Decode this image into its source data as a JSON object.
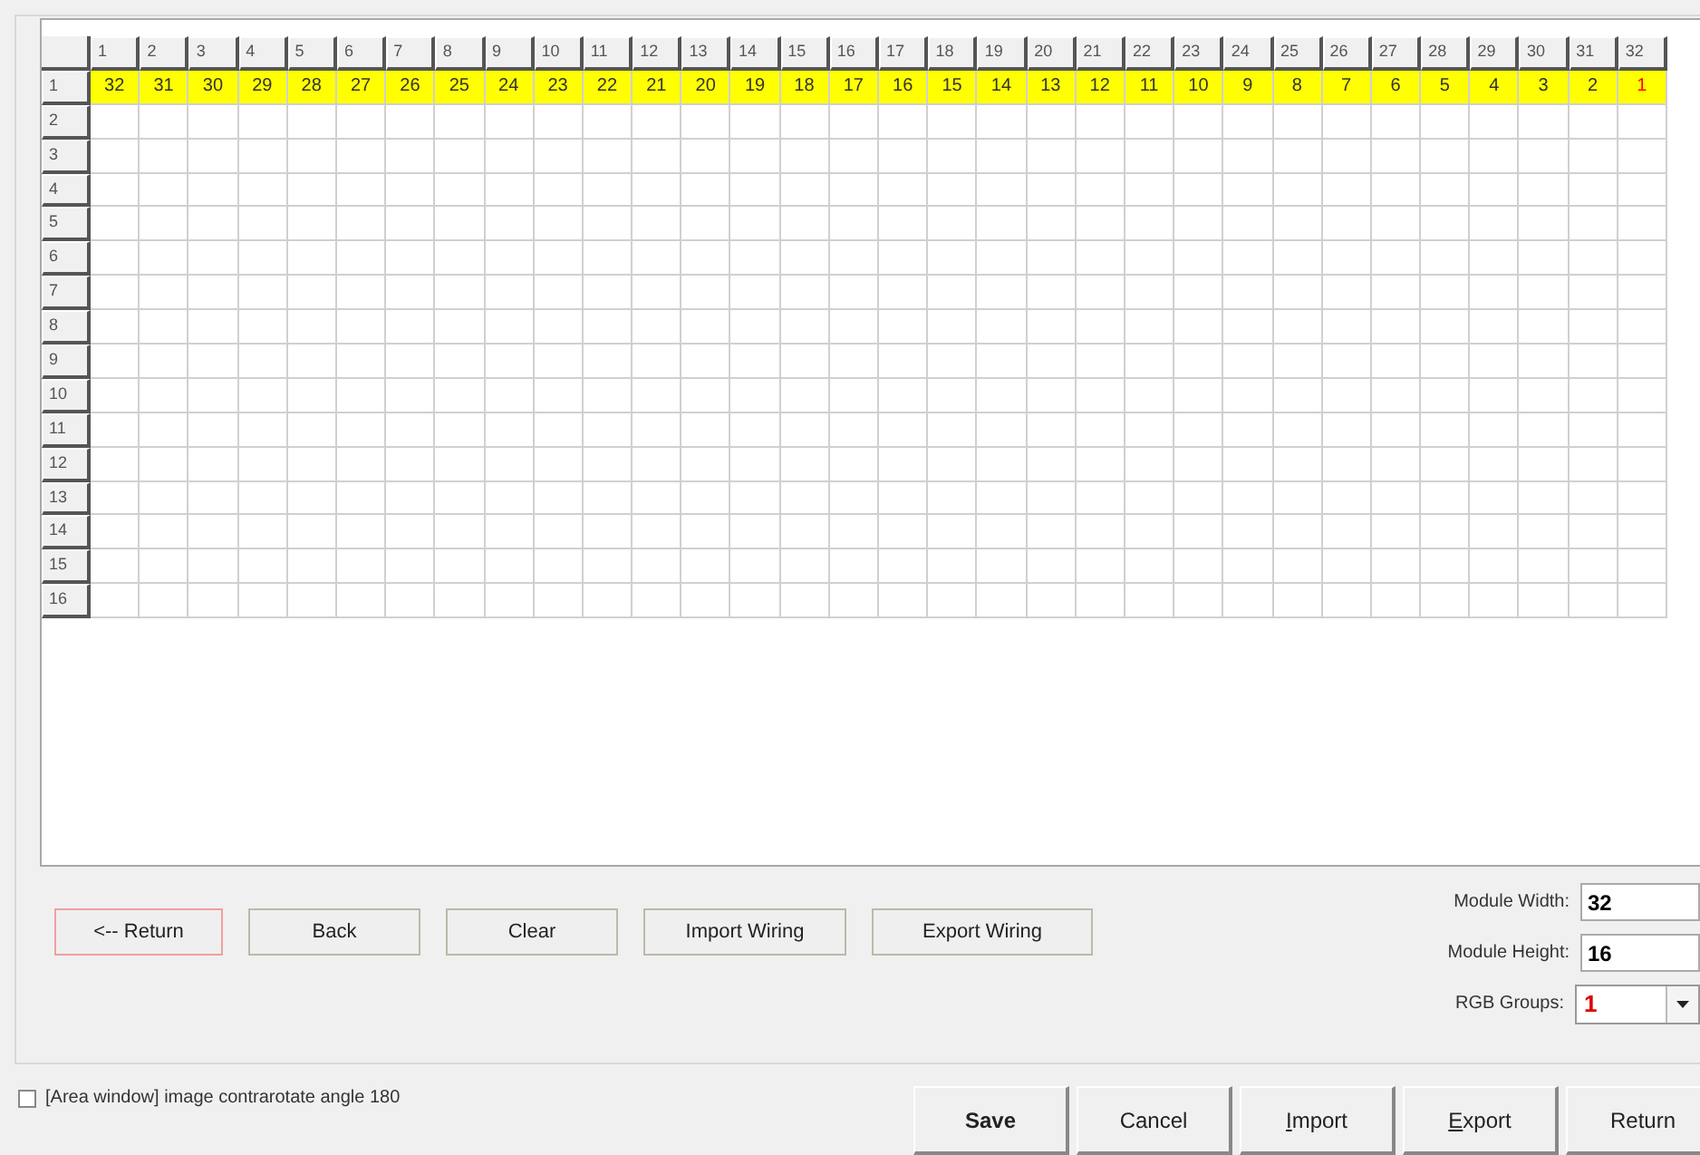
{
  "grid": {
    "column_headers": [
      "1",
      "2",
      "3",
      "4",
      "5",
      "6",
      "7",
      "8",
      "9",
      "10",
      "11",
      "12",
      "13",
      "14",
      "15",
      "16",
      "17",
      "18",
      "19",
      "20",
      "21",
      "22",
      "23",
      "24",
      "25",
      "26",
      "27",
      "28",
      "29",
      "30",
      "31",
      "32"
    ],
    "rows": [
      {
        "header": "1",
        "highlighted": true,
        "cells": [
          {
            "text": "32",
            "marked": false
          },
          {
            "text": "31",
            "marked": false
          },
          {
            "text": "30",
            "marked": false
          },
          {
            "text": "29",
            "marked": false
          },
          {
            "text": "28",
            "marked": false
          },
          {
            "text": "27",
            "marked": false
          },
          {
            "text": "26",
            "marked": false
          },
          {
            "text": "25",
            "marked": false
          },
          {
            "text": "24",
            "marked": false
          },
          {
            "text": "23",
            "marked": false
          },
          {
            "text": "22",
            "marked": false
          },
          {
            "text": "21",
            "marked": false
          },
          {
            "text": "20",
            "marked": false
          },
          {
            "text": "19",
            "marked": false
          },
          {
            "text": "18",
            "marked": false
          },
          {
            "text": "17",
            "marked": false
          },
          {
            "text": "16",
            "marked": false
          },
          {
            "text": "15",
            "marked": false
          },
          {
            "text": "14",
            "marked": false
          },
          {
            "text": "13",
            "marked": false
          },
          {
            "text": "12",
            "marked": false
          },
          {
            "text": "11",
            "marked": false
          },
          {
            "text": "10",
            "marked": false
          },
          {
            "text": "9",
            "marked": false
          },
          {
            "text": "8",
            "marked": false
          },
          {
            "text": "7",
            "marked": false
          },
          {
            "text": "6",
            "marked": false
          },
          {
            "text": "5",
            "marked": false
          },
          {
            "text": "4",
            "marked": false
          },
          {
            "text": "3",
            "marked": false
          },
          {
            "text": "2",
            "marked": false
          },
          {
            "text": "1",
            "marked": true
          }
        ]
      },
      {
        "header": "2",
        "highlighted": false
      },
      {
        "header": "3",
        "highlighted": false
      },
      {
        "header": "4",
        "highlighted": false
      },
      {
        "header": "5",
        "highlighted": false
      },
      {
        "header": "6",
        "highlighted": false
      },
      {
        "header": "7",
        "highlighted": false
      },
      {
        "header": "8",
        "highlighted": false
      },
      {
        "header": "9",
        "highlighted": false
      },
      {
        "header": "10",
        "highlighted": false
      },
      {
        "header": "11",
        "highlighted": false
      },
      {
        "header": "12",
        "highlighted": false
      },
      {
        "header": "13",
        "highlighted": false
      },
      {
        "header": "14",
        "highlighted": false
      },
      {
        "header": "15",
        "highlighted": false
      },
      {
        "header": "16",
        "highlighted": false
      }
    ]
  },
  "wiring_buttons": [
    {
      "label": "<-- Return",
      "focused": true
    },
    {
      "label": "Back",
      "focused": false
    },
    {
      "label": "Clear",
      "focused": false
    },
    {
      "label": "Import Wiring",
      "focused": false
    },
    {
      "label": "Export Wiring",
      "focused": false
    }
  ],
  "settings": [
    {
      "kind": "text",
      "label": "Module Width:",
      "value": "32"
    },
    {
      "kind": "text",
      "label": "Module Height:",
      "value": "16"
    },
    {
      "kind": "dropdown",
      "label": "RGB Groups:",
      "value": "1"
    }
  ],
  "rotate_option": {
    "label": "[Area window] image contrarotate angle 180",
    "checked": false
  },
  "dialog_buttons": [
    {
      "label": "Save",
      "default": true,
      "mnemonic": false
    },
    {
      "label": "Cancel",
      "default": false,
      "mnemonic": false
    },
    {
      "label": "Import",
      "default": false,
      "mnemonic": true
    },
    {
      "label": "Export",
      "default": false,
      "mnemonic": true
    },
    {
      "label": "Return",
      "default": false,
      "mnemonic": false
    }
  ]
}
